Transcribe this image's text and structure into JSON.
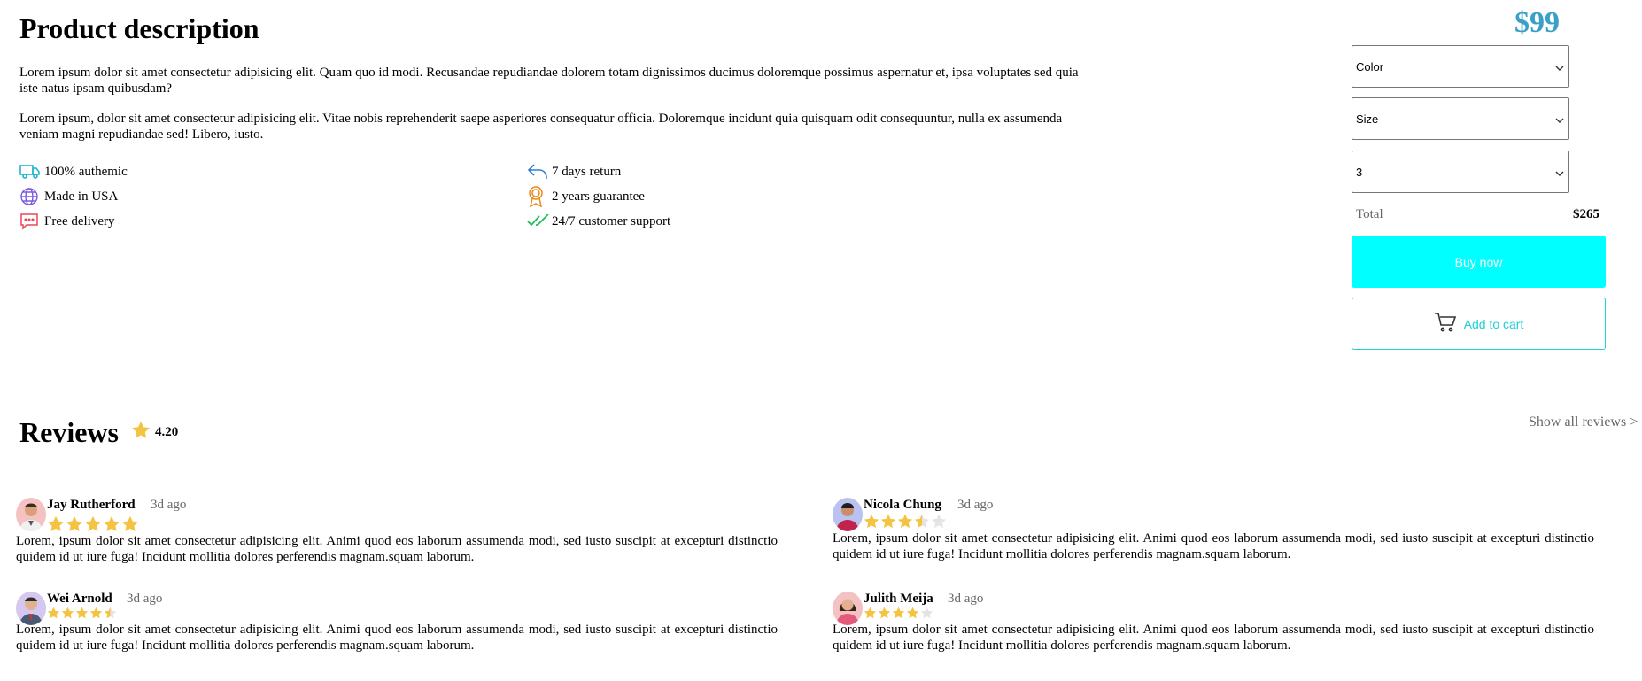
{
  "product": {
    "title": "Product description",
    "paragraphs": [
      "Lorem ipsum dolor sit amet consectetur adipisicing elit. Quam quo id modi. Recusandae repudiandae dolorem totam dignissimos ducimus doloremque possimus aspernatur et, ipsa voluptates sed quia iste natus ipsam quibusdam?",
      "Lorem ipsum, dolor sit amet consectetur adipisicing elit. Vitae nobis reprehenderit saepe asperiores consequatur officia. Doloremque incidunt quia quisquam odit consequuntur, nulla ex assumenda veniam magni repudiandae sed! Libero, iusto."
    ],
    "features": [
      {
        "label": "100% authemic",
        "icon": "truck-icon",
        "color": "#1fb6d1"
      },
      {
        "label": "Made in USA",
        "icon": "globe-icon",
        "color": "#7b5be0"
      },
      {
        "label": "Free delivery",
        "icon": "message-icon",
        "color": "#e8475a"
      },
      {
        "label": "7 days return",
        "icon": "return-arrow-icon",
        "color": "#2f7fd6"
      },
      {
        "label": "2 years guarantee",
        "icon": "award-icon",
        "color": "#e68a1a"
      },
      {
        "label": "24/7 customer support",
        "icon": "double-check-icon",
        "color": "#1fbf5a"
      }
    ]
  },
  "purchase": {
    "price": "$99",
    "price_color": "#3aa0c7",
    "color_select": "Color",
    "size_select": "Size",
    "quantity_select": "3",
    "total_label": "Total",
    "total_value": "$265",
    "buy_now_label": "Buy now",
    "add_to_cart_label": "Add to cart",
    "accent_color": "#00ffff"
  },
  "reviews": {
    "title": "Reviews",
    "average": "4.20",
    "show_all_label": "Show all reviews >",
    "items": [
      {
        "name": "Jay Rutherford",
        "time": "3d ago",
        "rating": 5,
        "text": "Lorem, ipsum dolor sit amet consectetur adipisicing elit. Animi quod eos laborum assumenda modi, sed iusto suscipit at excepturi distinctio quidem id ut iure fuga! Incidunt mollitia dolores perferendis magnam.squam laborum."
      },
      {
        "name": "Nicola Chung",
        "time": "3d ago",
        "rating": 3.5,
        "text": "Lorem, ipsum dolor sit amet consectetur adipisicing elit. Animi quod eos laborum assumenda modi, sed iusto suscipit at excepturi distinctio quidem id ut iure fuga! Incidunt mollitia dolores perferendis magnam.squam laborum."
      },
      {
        "name": "Wei Arnold",
        "time": "3d ago",
        "rating": 4.5,
        "text": "Lorem, ipsum dolor sit amet consectetur adipisicing elit. Animi quod eos laborum assumenda modi, sed iusto suscipit at excepturi distinctio quidem id ut iure fuga! Incidunt mollitia dolores perferendis magnam.squam laborum."
      },
      {
        "name": "Julith Meija",
        "time": "3d ago",
        "rating": 4,
        "text": "Lorem, ipsum dolor sit amet consectetur adipisicing elit. Animi quod eos laborum assumenda modi, sed iusto suscipit at excepturi distinctio quidem id ut iure fuga! Incidunt mollitia dolores perferendis magnam.squam laborum."
      }
    ]
  }
}
